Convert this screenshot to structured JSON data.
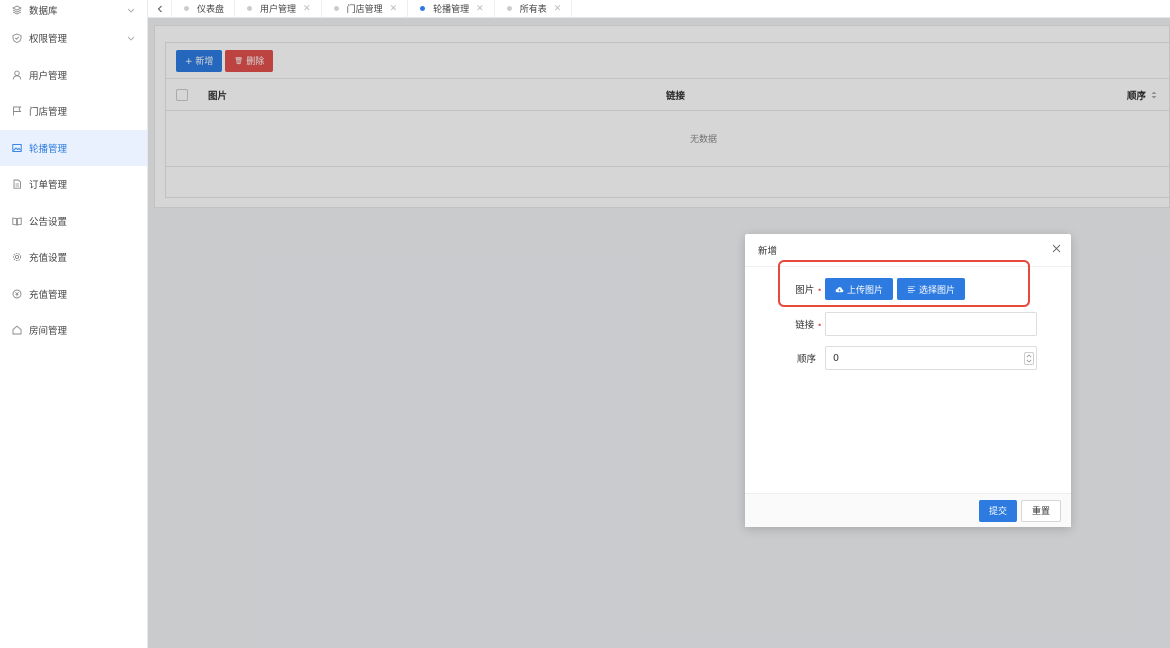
{
  "sidebar": {
    "items": [
      {
        "label": "数据库",
        "icon": "database-icon",
        "active": false,
        "chevron": true
      },
      {
        "label": "权限管理",
        "icon": "shield-icon",
        "active": false,
        "chevron": true
      },
      {
        "label": "用户管理",
        "icon": "user-icon",
        "active": false
      },
      {
        "label": "门店管理",
        "icon": "flag-icon",
        "active": false
      },
      {
        "label": "轮播管理",
        "icon": "image-icon",
        "active": true
      },
      {
        "label": "订单管理",
        "icon": "document-icon",
        "active": false
      },
      {
        "label": "公告设置",
        "icon": "book-icon",
        "active": false
      },
      {
        "label": "充值设置",
        "icon": "gear-icon",
        "active": false
      },
      {
        "label": "充值管理",
        "icon": "coin-icon",
        "active": false
      },
      {
        "label": "房间管理",
        "icon": "home-icon",
        "active": false
      }
    ]
  },
  "tabs": [
    {
      "label": "仪表盘",
      "active": false,
      "closable": false
    },
    {
      "label": "用户管理",
      "active": false,
      "closable": true
    },
    {
      "label": "门店管理",
      "active": false,
      "closable": true
    },
    {
      "label": "轮播管理",
      "active": true,
      "closable": false
    },
    {
      "label": "所有表",
      "active": false,
      "closable": true
    }
  ],
  "toolbar": {
    "add_label": "+ 新增",
    "delete_label": "删除"
  },
  "table": {
    "columns": [
      "图片",
      "链接",
      "顺序"
    ],
    "empty_text": "无数据"
  },
  "modal": {
    "title": "新增",
    "image_label": "图片",
    "upload_label": "上传图片",
    "choose_label": "选择图片",
    "link_label": "链接",
    "link_value": "",
    "order_label": "顺序",
    "order_value": "0",
    "submit_label": "提交",
    "reset_label": "重置"
  },
  "colors": {
    "primary": "#2d7be0",
    "danger": "#e0504d",
    "highlight": "#e64a3b"
  }
}
